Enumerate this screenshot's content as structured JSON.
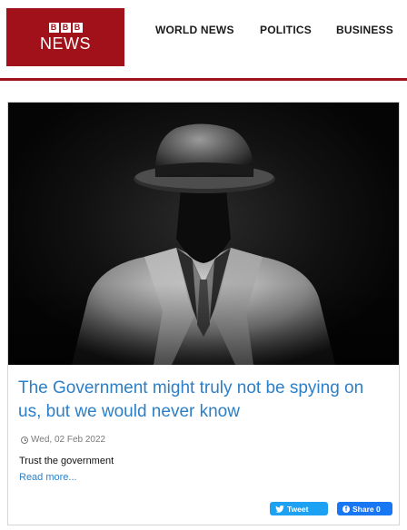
{
  "header": {
    "logo_blocks": [
      "B",
      "B",
      "B"
    ],
    "logo_text": "NEWS",
    "nav": [
      "WORLD NEWS",
      "POLITICS",
      "BUSINESS"
    ],
    "brand_color": "#a0111a"
  },
  "article": {
    "title": "The Government might truly not be spying on us, but we would never know",
    "date": "Wed, 02 Feb 2022",
    "summary": "Trust the government",
    "read_more": "Read more...",
    "image_icon": "man-in-fedora-and-trenchcoat-image"
  },
  "share": {
    "tweet": "Tweet",
    "facebook": "Share 0",
    "tweet_color": "#1da1f2",
    "facebook_color": "#1877f2"
  }
}
